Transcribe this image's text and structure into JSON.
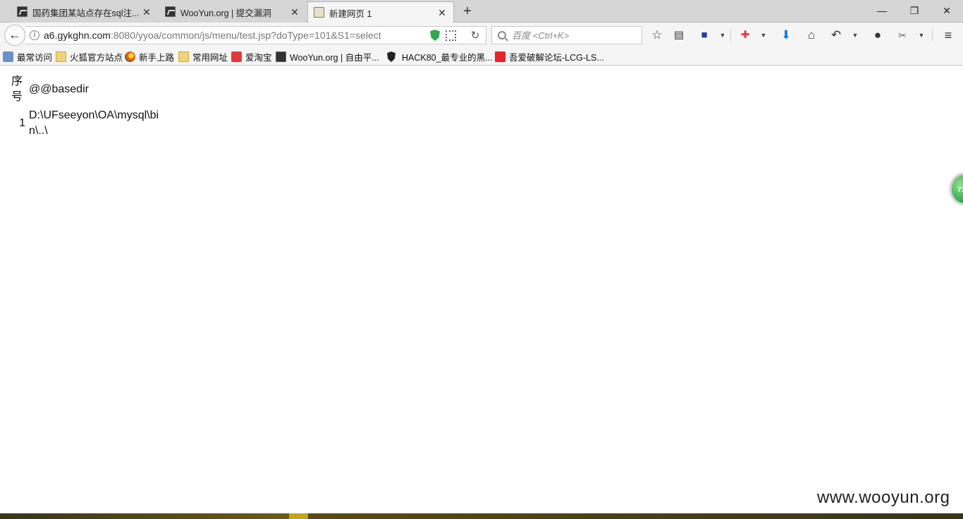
{
  "tabs": [
    {
      "title": "国药集团某站点存在sql注...",
      "active": false
    },
    {
      "title": "WooYun.org | 提交漏洞",
      "active": false
    },
    {
      "title": "新建网页 1",
      "active": true
    }
  ],
  "window": {
    "minimize": "—",
    "restore": "❐",
    "close": "✕"
  },
  "navbar": {
    "url_host": "a6.gykghn.com",
    "url_rest": ":8080/yyoa/common/js/menu/test.jsp?doType=101&S1=select",
    "search_placeholder": "百度 <Ctrl+K>"
  },
  "bookmarks": [
    {
      "label": "最常访问",
      "icon": "recent-icon"
    },
    {
      "label": "火狐官方站点",
      "icon": "folder-icon"
    },
    {
      "label": "新手上路",
      "icon": "firefox-icon"
    },
    {
      "label": "常用网址",
      "icon": "folder-icon"
    },
    {
      "label": "爱淘宝",
      "icon": "taobao-icon"
    },
    {
      "label": "WooYun.org | 自由平...",
      "icon": "wooyun-icon"
    },
    {
      "label": "HACK80_最专业的黑...",
      "icon": "hack80-icon"
    },
    {
      "label": "吾爱破解论坛-LCG-LS...",
      "icon": "52pojie-icon"
    }
  ],
  "table": {
    "headers": [
      "序号",
      "@@basedir"
    ],
    "rows": [
      {
        "index": "1",
        "value": "D:\\UFseeyon\\OA\\mysql\\bin\\..\\"
      }
    ]
  },
  "badge": {
    "text": "71"
  },
  "watermark": "www.wooyun.org",
  "colors": {
    "shield": "#2fa84f",
    "badge": "#2fa84f",
    "download": "#1a7fe0",
    "save": "#1f3fa8",
    "addon": "#e4393c"
  }
}
